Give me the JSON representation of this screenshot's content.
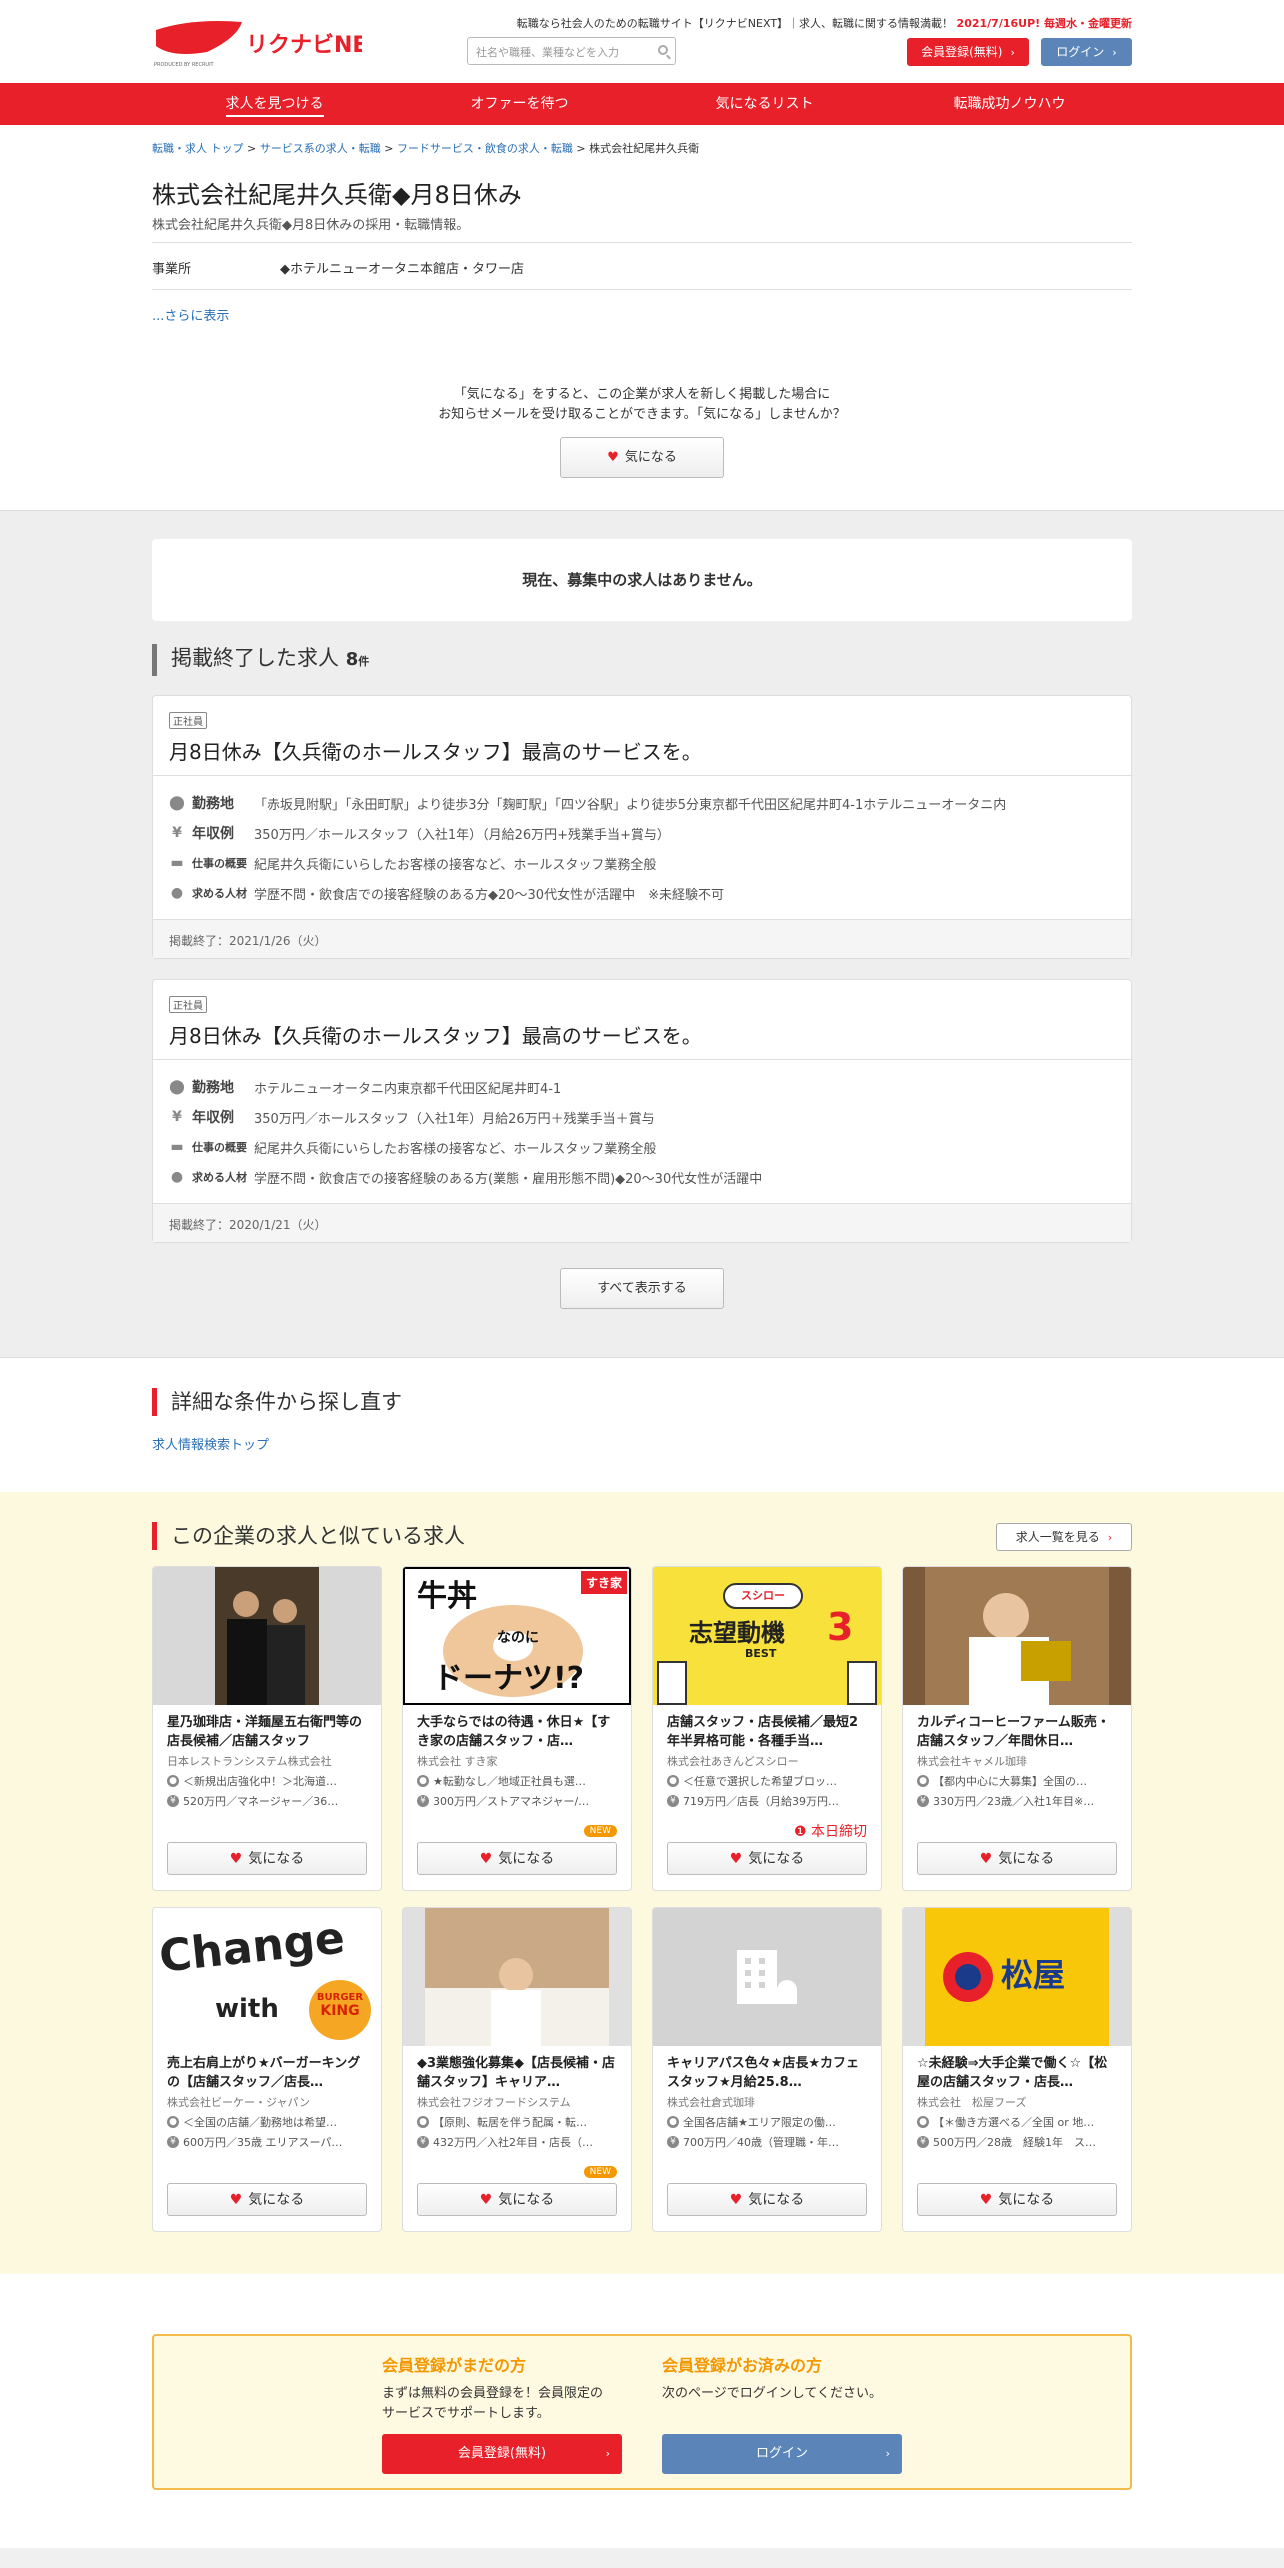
{
  "header": {
    "logo_text": "リクナビNEXT",
    "logo_sub": "PRODUCED BY RECRUIT",
    "tagline_prefix": "転職なら社会人のための転職サイト【リクナビNEXT】｜求人、転職に関する情報満載！",
    "tagline_highlight": "2021/7/16UP! 毎週水・金曜更新",
    "search_placeholder": "社名や職種、業種などを入力",
    "register_label": "会員登録(無料)",
    "login_label": "ログイン"
  },
  "nav": {
    "items": [
      "求人を見つける",
      "オファーを待つ",
      "気になるリスト",
      "転職成功ノウハウ"
    ]
  },
  "breadcrumb": [
    "転職・求人 トップ",
    "サービス系の求人・転職",
    "フードサービス・飲食の求人・転職",
    "株式会社紀尾井久兵衛"
  ],
  "company": {
    "title": "株式会社紀尾井久兵衛◆月8日休み",
    "subtitle": "株式会社紀尾井久兵衛◆月8日休みの採用・転職情報。",
    "office_label": "事業所",
    "office_value": "◆ホテルニューオータニ本館店・タワー店",
    "more_label": "...さらに表示",
    "fav_message_1": "「気になる」をすると、この企業が求人を新しく掲載した場合に",
    "fav_message_2": "お知らせメールを受け取ることができます。「気になる」しませんか？",
    "fav_button": "気になる"
  },
  "jobs": {
    "no_jobs": "現在、募集中の求人はありません。",
    "ended_title": "掲載終了した求人",
    "ended_count": "8",
    "ended_unit": "件",
    "labels": {
      "location": "勤務地",
      "salary": "年収例",
      "summary": "仕事の概要",
      "wanted": "求める人材"
    },
    "cards": [
      {
        "tag": "正社員",
        "title": "月8日休み【久兵衛のホールスタッフ】最高のサービスを。",
        "location": "「赤坂見附駅」「永田町駅」より徒歩3分「麹町駅」「四ツ谷駅」より徒歩5分東京都千代田区紀尾井町4-1ホテルニューオータニ内",
        "salary": "350万円／ホールスタッフ（入社1年）（月給26万円+残業手当+賞与）",
        "summary": "紀尾井久兵衛にいらしたお客様の接客など、ホールスタッフ業務全般",
        "wanted": "学歴不問・飲食店での接客経験のある方◆20～30代女性が活躍中　※未経験不可",
        "ended": "掲載終了：2021/1/26（火）"
      },
      {
        "tag": "正社員",
        "title": "月8日休み【久兵衛のホールスタッフ】最高のサービスを。",
        "location": "ホテルニューオータニ内東京都千代田区紀尾井町4-1",
        "salary": "350万円／ホールスタッフ（入社1年）月給26万円＋残業手当＋賞与",
        "summary": "紀尾井久兵衛にいらしたお客様の接客など、ホールスタッフ業務全般",
        "wanted": "学歴不問・飲食店での接客経験のある方(業態・雇用形態不問)◆20～30代女性が活躍中",
        "ended": "掲載終了：2020/1/21（火）"
      }
    ],
    "show_all": "すべて表示する"
  },
  "detail_search": {
    "title": "詳細な条件から探し直す",
    "link": "求人情報検索トップ"
  },
  "similar": {
    "title": "この企業の求人と似ている求人",
    "list_button": "求人一覧を見る",
    "fav_label": "気になる",
    "new_label": "NEW",
    "closing_label": "本日締切",
    "cards": [
      {
        "title": "星乃珈琲店・洋麺屋五右衛門等の店長候補／店舗スタッフ",
        "company": "日本レストランシステム株式会社",
        "loc": "＜新規出店強化中！＞北海道…",
        "sal": "520万円／マネージャー／36…",
        "badge": ""
      },
      {
        "title": "大手ならではの待遇・休日★【すき家の店舗スタッフ・店…",
        "company": "株式会社 すき家",
        "loc": "★転勤なし／地域正社員も選…",
        "sal": "300万円／ストアマネジャー/…",
        "badge": "new",
        "img_text_1": "牛丼",
        "img_text_2": "なのに",
        "img_text_3": "ドーナツ!?",
        "img_logo": "すき家"
      },
      {
        "title": "店舗スタッフ・店長候補／最短2年半昇格可能・各種手当…",
        "company": "株式会社あきんどスシロー",
        "loc": "＜任意で選択した希望ブロッ…",
        "sal": "719万円／店長（月給39万円…",
        "badge": "closing",
        "img_text_1": "スシロー",
        "img_text_2": "志望動機",
        "img_text_3": "BEST",
        "img_num": "3"
      },
      {
        "title": "カルディコーヒーファーム販売・店舗スタッフ／年間休日…",
        "company": "株式会社キャメル珈琲",
        "loc": "【都内中心に大募集】全国の…",
        "sal": "330万円／23歳／入社1年目※…",
        "badge": ""
      },
      {
        "title": "売上右肩上がり★バーガーキングの【店舗スタッフ／店長…",
        "company": "株式会社ビーケー・ジャパン",
        "loc": "＜全国の店舗／勤務地は希望…",
        "sal": "600万円／35歳 エリアスーパ…",
        "badge": "",
        "img_text_1": "Change",
        "img_text_2": "with",
        "img_logo_1": "BURGER",
        "img_logo_2": "KING"
      },
      {
        "title": "◆3業態強化募集◆【店長候補・店舗スタッフ】キャリア…",
        "company": "株式会社フジオフードシステム",
        "loc": "【原則、転居を伴う配属・転…",
        "sal": "432万円／入社2年目・店長（…",
        "badge": "new"
      },
      {
        "title": "キャリアパス色々★店長★カフェスタッフ★月給25.8…",
        "company": "株式会社倉式珈琲",
        "loc": "全国各店舗★エリア限定の働…",
        "sal": "700万円／40歳（管理職・年…",
        "badge": ""
      },
      {
        "title": "☆未経験⇒大手企業で働く☆【松屋の店舗スタッフ・店長…",
        "company": "株式会社　松屋フーズ",
        "loc": "【＊働き方選べる／全国 or 地…",
        "sal": "500万円／28歳　経験1年　ス…",
        "badge": "",
        "img_logo": "松屋"
      }
    ]
  },
  "member": {
    "new_title": "会員登録がまだの方",
    "new_text_1": "まずは無料の会員登録を！会員限定の",
    "new_text_2": "サービスでサポートします。",
    "new_button": "会員登録(無料)",
    "exist_title": "会員登録がお済みの方",
    "exist_text": "次のページでログインしてください。",
    "exist_button": "ログイン"
  },
  "colors": {
    "brand_red": "#e8202a",
    "login_blue": "#5b85b9",
    "accent_orange": "#f39800",
    "yellow_bg": "#fcf9de"
  }
}
